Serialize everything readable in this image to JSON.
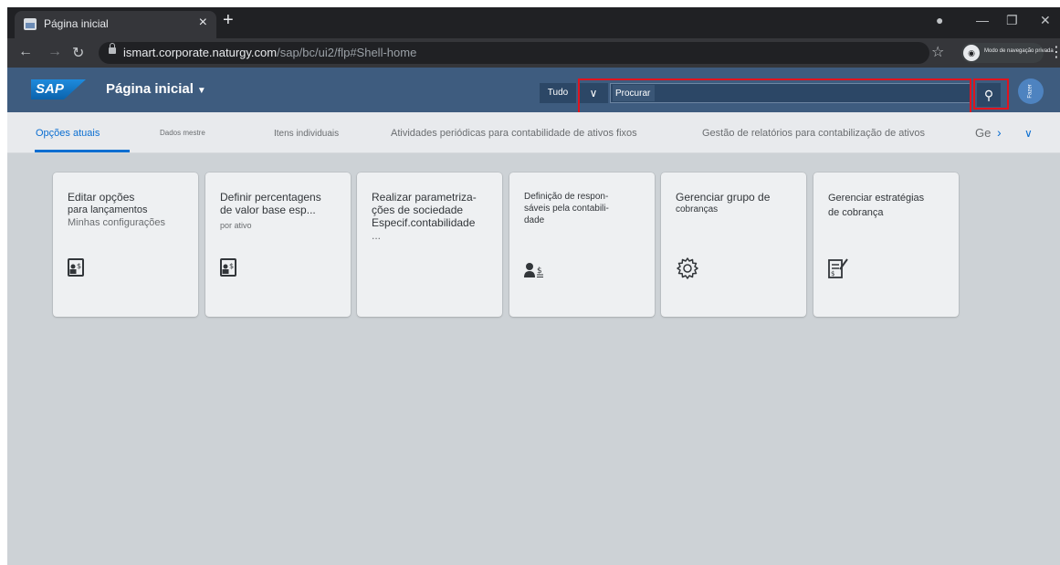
{
  "browser": {
    "tab_title": "Página inicial",
    "tab_close": "×",
    "new_tab": "+",
    "url_host": "ismart.corporate.naturgy.com",
    "url_path": "/sap/bc/ui2/flp#Shell-home",
    "incognito_label": "Modo de navegação privada"
  },
  "shell": {
    "logo": "SAP",
    "title": "Página inicial",
    "scope_label": "Tudo",
    "search_placeholder": "Procurar",
    "avatar_text": "Fazer"
  },
  "anchor_bar": {
    "items": [
      {
        "label": "Opções atuais"
      },
      {
        "label": "Dados mestre"
      },
      {
        "label": "Itens individuais"
      },
      {
        "label": "Atividades periódicas para contabilidade de ativos fixos"
      },
      {
        "label": "Gestão de relatórios para contabilização de ativos"
      },
      {
        "label": "Ge"
      }
    ]
  },
  "tiles": [
    {
      "line1": "Editar opções",
      "line2": "para lançamentos",
      "line3": "Minhas configurações",
      "icon": "person-dollar-doc-icon"
    },
    {
      "line1": "Definir percentagens",
      "line2": "de valor base esp...",
      "line3": "por ativo",
      "icon": "person-dollar-doc-icon"
    },
    {
      "line1": "Realizar parametriza-",
      "line2": "ções de sociedade",
      "line3": "Especif.contabilidade",
      "line4": "...",
      "icon": ""
    },
    {
      "line1": "Definição de respon-",
      "line2": "sáveis pela contabili-",
      "line3": "dade",
      "icon": "person-dollar-icon"
    },
    {
      "line1": "Gerenciar grupo de",
      "line2": "cobranças",
      "icon": "gear-icon"
    },
    {
      "line1": "Gerenciar estratégias",
      "line2": "de cobrança",
      "icon": "edit-invoice-icon"
    }
  ]
}
